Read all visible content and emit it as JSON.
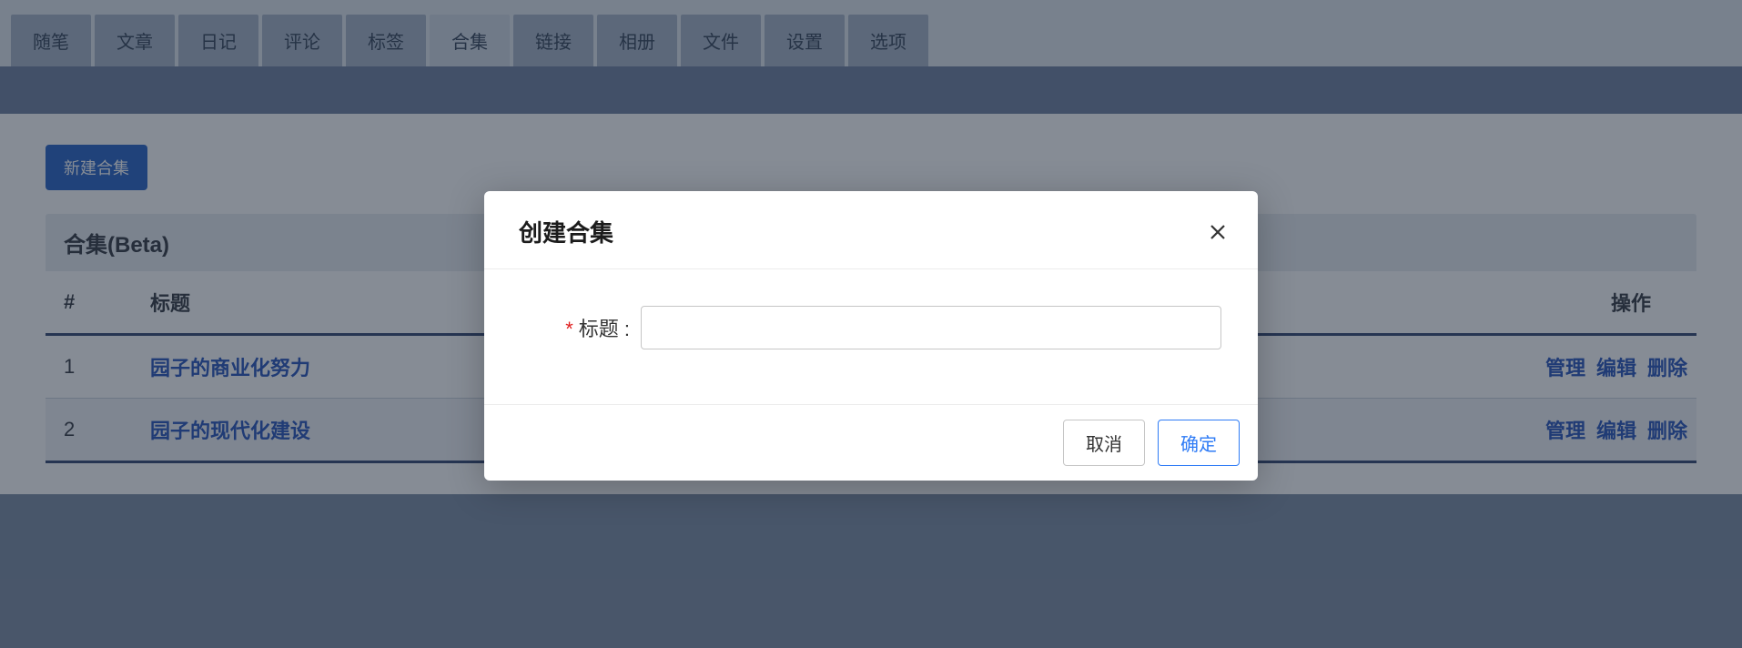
{
  "tabs": [
    "随笔",
    "文章",
    "日记",
    "评论",
    "标签",
    "合集",
    "链接",
    "相册",
    "文件",
    "设置",
    "选项"
  ],
  "activeTabIndex": 5,
  "newCollectionBtn": "新建合集",
  "sectionTitle": "合集(Beta)",
  "columns": {
    "index": "#",
    "title": "标题",
    "actions": "操作"
  },
  "actionLabels": {
    "manage": "管理",
    "edit": "编辑",
    "delete": "删除"
  },
  "rows": [
    {
      "idx": "1",
      "title": "园子的商业化努力"
    },
    {
      "idx": "2",
      "title": "园子的现代化建设"
    }
  ],
  "modal": {
    "title": "创建合集",
    "requiredMark": "*",
    "fieldLabel": "标题 :",
    "inputValue": "",
    "cancel": "取消",
    "confirm": "确定"
  }
}
